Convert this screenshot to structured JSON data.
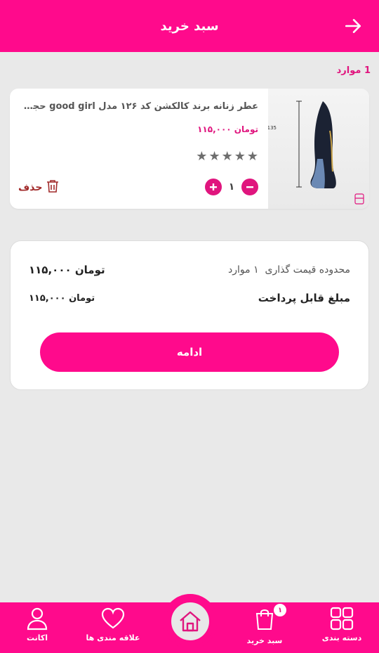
{
  "header": {
    "title": "سبد خرید"
  },
  "cart": {
    "items_count": "1 موارد"
  },
  "item": {
    "name": "عطر زنانه برند کالکشن کد ۱۲۶ مدل good girl حجم ۲۵ ...",
    "price": "تومان ۱۱۵,۰۰۰",
    "rating_stars": 5,
    "quantity": "۱",
    "delete_label": "حذف",
    "image_text": "135 mm"
  },
  "summary": {
    "range_label": "محدوده قیمت گذاری",
    "range_count": "۱ موارد",
    "range_price": "تومان ۱۱۵,۰۰۰",
    "payable_label": "مبلغ قابل پرداخت",
    "payable_price": "تومان ۱۱۵,۰۰۰",
    "continue_label": "ادامه"
  },
  "nav": {
    "categories": "دسته بندی",
    "cart": "سبد خرید",
    "cart_badge": "۱",
    "favorites": "علاقه مندی ها",
    "account": "اکانت"
  },
  "colors": {
    "brand": "#ff0a8c",
    "accent_text": "#e0157e",
    "delete": "#a12a2a"
  }
}
